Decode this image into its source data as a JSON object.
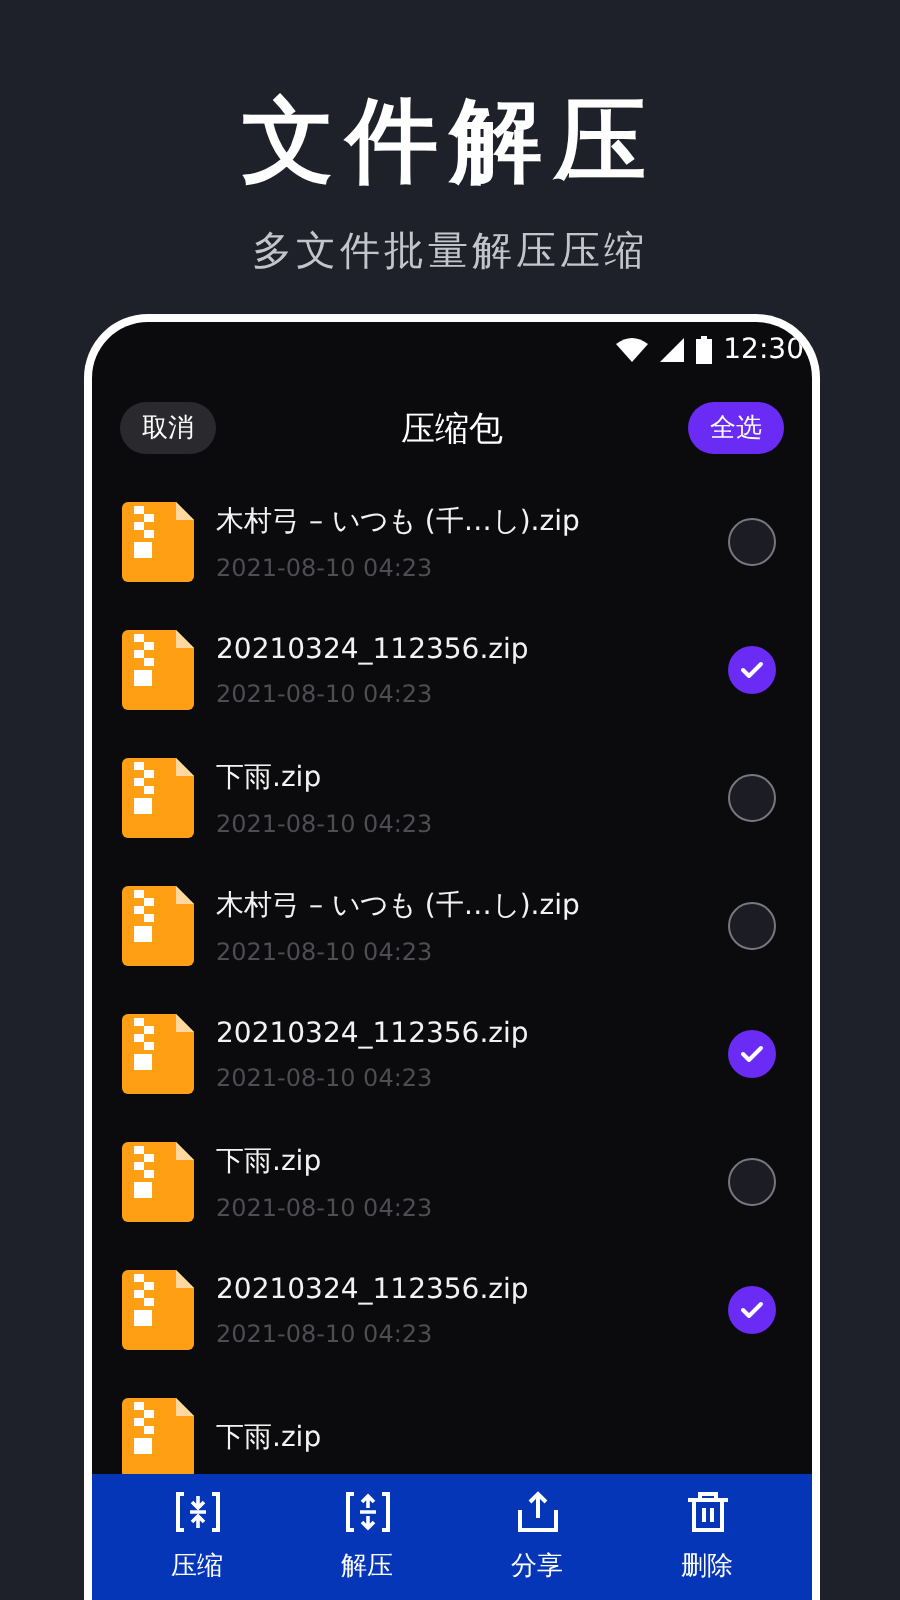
{
  "headline": {
    "title": "文件解压",
    "subtitle": "多文件批量解压压缩"
  },
  "status_bar": {
    "time": "12:30"
  },
  "header": {
    "cancel": "取消",
    "title": "压缩包",
    "select_all": "全选"
  },
  "files": [
    {
      "name": "木村弓 – いつも (千…し).zip",
      "date": "2021-08-10 04:23",
      "selected": false
    },
    {
      "name": "20210324_112356.zip",
      "date": "2021-08-10 04:23",
      "selected": true
    },
    {
      "name": "下雨.zip",
      "date": "2021-08-10 04:23",
      "selected": false
    },
    {
      "name": "木村弓 – いつも (千…し).zip",
      "date": "2021-08-10 04:23",
      "selected": false
    },
    {
      "name": "20210324_112356.zip",
      "date": "2021-08-10 04:23",
      "selected": true
    },
    {
      "name": "下雨.zip",
      "date": "2021-08-10 04:23",
      "selected": false
    },
    {
      "name": "20210324_112356.zip",
      "date": "2021-08-10 04:23",
      "selected": true
    },
    {
      "name": "下雨.zip"
    }
  ],
  "toolbar": [
    {
      "label": "压缩",
      "kind": "compress"
    },
    {
      "label": "解压",
      "kind": "extract"
    },
    {
      "label": "分享",
      "kind": "share"
    },
    {
      "label": "删除",
      "kind": "delete"
    }
  ]
}
